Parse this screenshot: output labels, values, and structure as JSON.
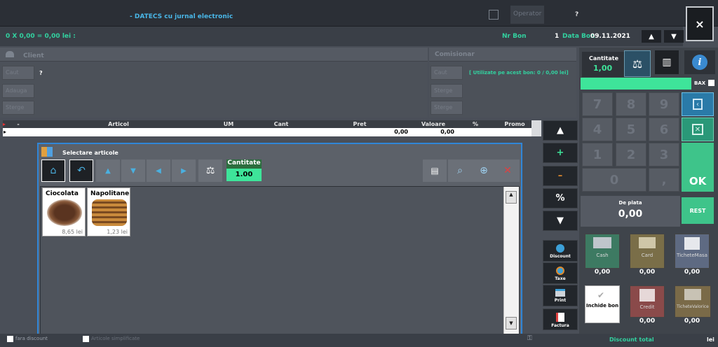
{
  "header": {
    "title": "- DATECS cu jurnal electronic",
    "operator_label": "Operator",
    "question_mark": "?",
    "close_glyph": "×"
  },
  "summary": {
    "total_line": "0 X 0,00 = 0,00 lei :",
    "nr_bon_label": "Nr Bon",
    "nr_bon_value": "1",
    "data_bon_label": "Data Bon",
    "data_bon_value": "09.11.2021"
  },
  "client_panel": {
    "title": "Client",
    "value_mark": "?",
    "buttons": [
      "Caut",
      "Adauga",
      "Sterge"
    ]
  },
  "comisionar_panel": {
    "title": "Comisionar",
    "info": "[ Utilizate pe acest bon: 0 / 0,00 lei]",
    "buttons": [
      "Caut",
      "Sterge",
      "Sterge"
    ]
  },
  "table": {
    "columns": [
      "-",
      "Articol",
      "UM",
      "Cant",
      "Pret",
      "Valoare",
      "%",
      "Promo"
    ],
    "row": {
      "pret": "0,00",
      "valoare": "0,00"
    }
  },
  "dialog": {
    "title": "Selectare articole",
    "qty_label": "Cantitate",
    "qty_value": "1.00",
    "products": [
      {
        "name": "Ciocolata",
        "price": "8,65 lei"
      },
      {
        "name": "Napolitane",
        "price": "1,23 lei"
      }
    ]
  },
  "side_buttons": {
    "up": "▲",
    "plus": "+",
    "minus": "–",
    "percent": "%",
    "down": "▼",
    "discount": "Discount",
    "taxe": "Taxe",
    "print": "Print",
    "factura": "Factura"
  },
  "right_panel": {
    "qty_label": "Cantitate",
    "qty_value": "1,00",
    "bax_label": "BAX",
    "keys": [
      "7",
      "8",
      "9",
      "4",
      "5",
      "6",
      "1",
      "2",
      "3",
      "0",
      ","
    ],
    "ok_label": "OK",
    "de_plata_label": "De plata",
    "de_plata_value": "0,00",
    "rest_label": "REST",
    "payments": [
      {
        "label": "Cash",
        "value": "0,00",
        "color": "#3d7a62"
      },
      {
        "label": "Card",
        "value": "0,00",
        "color": "#7a6e48"
      },
      {
        "label": "TicheteMasa",
        "value": "0,00",
        "color": "#5e6a82"
      },
      {
        "label": "Credit",
        "value": "0,00",
        "color": "#8a4a4a"
      },
      {
        "label": "TicheteValorice",
        "value": "0,00",
        "color": "#7a6a48"
      }
    ],
    "inchide_bon": "Inchide bon",
    "discount_total": "Discount total",
    "currency": "lei"
  },
  "footer": {
    "fara_discount": "fara discount",
    "articole_label": "Articole simplificate"
  },
  "colors": {
    "accent_green": "#32d2a0",
    "accent_blue": "#3086d8",
    "title_blue": "#49b7e8"
  }
}
